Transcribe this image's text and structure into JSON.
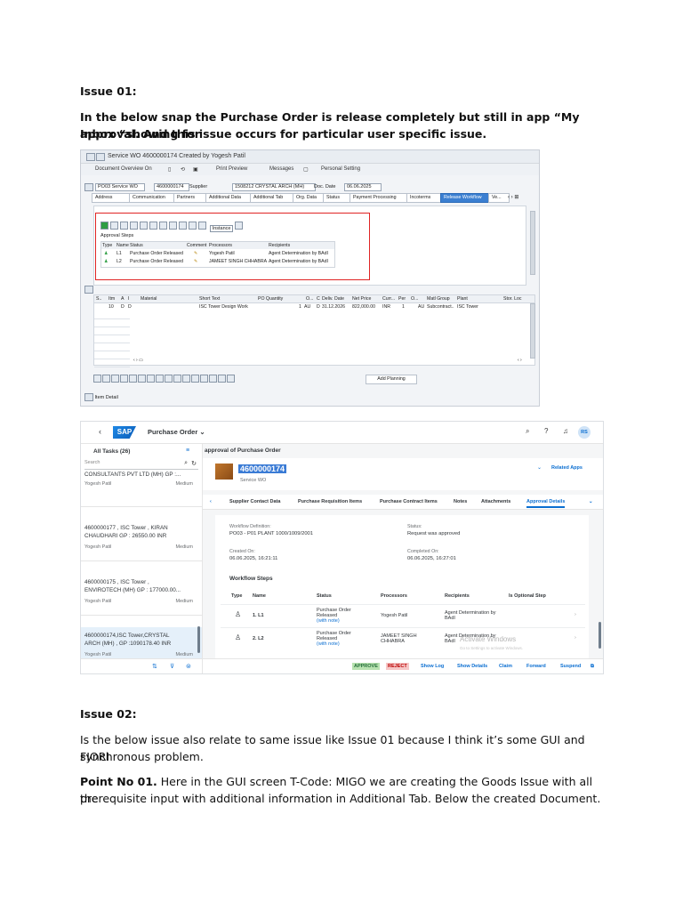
{
  "issue1": {
    "heading": "Issue 01:",
    "paragraph_line1": "In the below snap the Purchase Order is release completely but still in app “My Inbox “showing for",
    "paragraph_line2": "approval. And this issue occurs for particular user specific issue."
  },
  "gui": {
    "window_title": "Service WO 4600000174 Created by Yogesh Patil",
    "menu": [
      "Document Overview On",
      "Print Preview",
      "Messages",
      "Personal Setting"
    ],
    "header_fields": {
      "doc_type": "PO03 Service WO",
      "po_number": "4600000174",
      "supplier_label": "Supplier",
      "supplier_value": "1508212 CRYSTAL ARCH (MH)",
      "doc_date_label": "Doc. Date",
      "doc_date_value": "06.06.2025"
    },
    "tabs": [
      "Address",
      "Communication",
      "Partners",
      "Additional Data",
      "Additional Tab",
      "Org. Data",
      "Status",
      "Payment Processing",
      "Incoterms",
      "Release Workflow",
      "Ve..."
    ],
    "active_tab": "Release Workflow",
    "instance_label": "Instance",
    "approval_steps_label": "Approval Steps",
    "wf_columns": [
      "Type",
      "Name",
      "Status",
      "Comment",
      "Processors",
      "Recipients"
    ],
    "wf_rows": [
      {
        "name": "L1",
        "status": "Purchase Order Released",
        "processor": "Yogesh Patil",
        "recipient": "Agent Determination by BAdI"
      },
      {
        "name": "L2",
        "status": "Purchase Order Released",
        "processor": "JAMEET SINGH CHHABRA",
        "recipient": "Agent Determination by BAdI"
      }
    ],
    "item_columns": [
      "S..",
      "Itm",
      "A",
      "I",
      "Material",
      "Short Text",
      "PO Quantity",
      "O...",
      "C",
      "Deliv. Date",
      "Net Price",
      "Curr...",
      "Per",
      "O...",
      "Matl Group",
      "Plant",
      "Stor. Loc"
    ],
    "item_row": {
      "itm": "10",
      "a": "D",
      "i": "D",
      "short_text": "ISC Tower Design Work",
      "qty": "1",
      "unit": "AU",
      "c": "D",
      "deliv": "31.12.2026",
      "net_price": "822,000.00",
      "curr": "INR",
      "per": "1",
      "o": "AU",
      "matl_group": "Subcontract..",
      "plant": "ISC Tower"
    },
    "add_planning": "Add Planning",
    "item_detail": "Item Detail"
  },
  "fiori": {
    "app_title": "Purchase Order",
    "avatar_initials": "RS",
    "all_tasks": "All Tasks (26)",
    "search_placeholder": "Search",
    "list_items": [
      {
        "line1": "CONSULTANTS PVT LTD (MH) GP :...",
        "line2": "",
        "user": "Yogesh Patil",
        "priority": "Medium"
      },
      {
        "line1": "4600000177 , ISC Tower , KIRAN",
        "line2": "CHAUDHARI GP : 26550.00 INR",
        "user": "Yogesh Patil",
        "priority": "Medium"
      },
      {
        "line1": "4600000175 , ISC Tower ,",
        "line2": "ENVIROTECH (MH) GP : 177000.00...",
        "user": "Yogesh Patil",
        "priority": "Medium"
      },
      {
        "line1": "4600000174,ISC Tower,CRYSTAL",
        "line2": "ARCH (MH) , GP :1090178.40 INR",
        "user": "Yogesh Patil",
        "priority": "Medium"
      }
    ],
    "detail_title": "approval of Purchase Order",
    "object_number": "4600000174",
    "object_subtitle": "Service WO",
    "related_apps": "Related Apps",
    "tabs": [
      "Supplier Contact Data",
      "Purchase Requisition Items",
      "Purchase Contract Items",
      "Notes",
      "Attachments",
      "Approval Details"
    ],
    "active_tab": "Approval Details",
    "workflow_definition_label": "Workflow Definition:",
    "workflow_definition_value": "PO03 - P01 PLANT 1000/1009/2001",
    "status_label": "Status:",
    "status_value": "Request was approved",
    "created_on_label": "Created On:",
    "created_on_value": "06.06.2025, 16:21:11",
    "completed_on_label": "Completed On:",
    "completed_on_value": "06.06.2025, 16:27:01",
    "workflow_steps_title": "Workflow Steps",
    "steps_columns": [
      "Type",
      "Name",
      "Status",
      "Processors",
      "Recipients",
      "Is Optional Step"
    ],
    "steps": [
      {
        "name": "1. L1",
        "status1": "Purchase Order",
        "status2": "Released",
        "note": "(with note)",
        "processor1": "Yogesh Patil",
        "processor2": "",
        "recipient1": "Agent Determination by",
        "recipient2": "BAdI"
      },
      {
        "name": "2. L2",
        "status1": "Purchase Order",
        "status2": "Released",
        "note": "(with note)",
        "processor1": "JAMEET SINGH",
        "processor2": "CHHABRA",
        "recipient1": "Agent Determination by",
        "recipient2": "BAdI"
      }
    ],
    "footer_buttons": [
      "APPROVE",
      "REJECT",
      "Show Log",
      "Show Details",
      "Claim",
      "Forward",
      "Suspend"
    ],
    "watermark_line1": "Activate Windows",
    "watermark_line2": "Go to Settings to activate Windows."
  },
  "issue2": {
    "heading": "Issue 02:",
    "paragraph_line1": "Is the below issue also relate to same issue like Issue 01 because I think it’s some GUI and FIORI",
    "paragraph_line2": "synchronous problem.",
    "point_label": "Point No 01.",
    "point_text_line1": " Here in the GUI screen T-Code: MIGO we are creating the Goods Issue with all the",
    "point_text_line2": "prerequisite input with additional information in Additional Tab. Below the created Document."
  }
}
